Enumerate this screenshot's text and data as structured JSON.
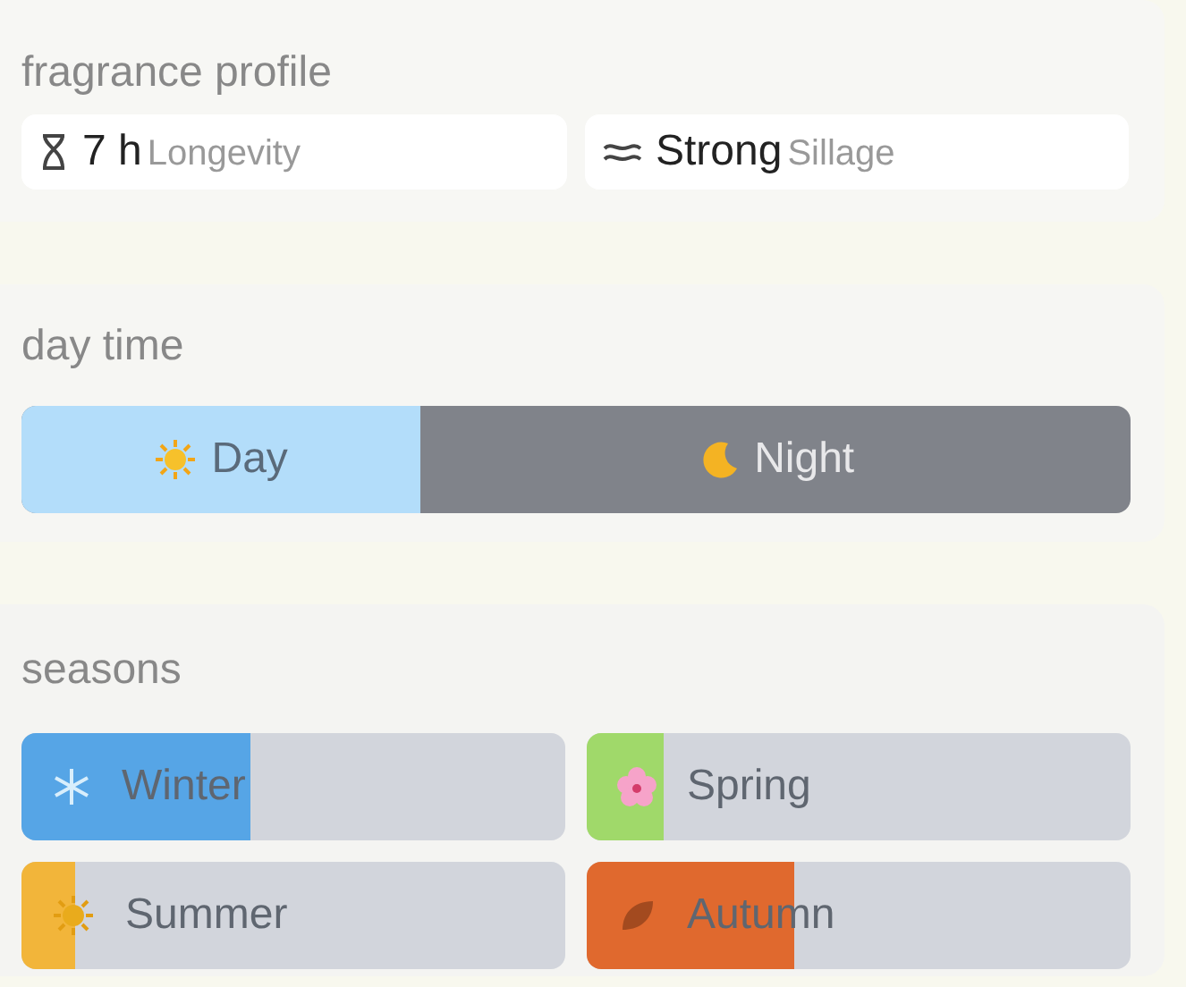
{
  "fragrance_profile": {
    "title": "fragrance profile",
    "stats": [
      {
        "kind": "longevity",
        "value": "7 h",
        "label": "Longevity"
      },
      {
        "kind": "sillage",
        "value": "Strong",
        "label": "Sillage"
      }
    ]
  },
  "day_time": {
    "title": "day time",
    "level": 0.36,
    "options": [
      {
        "kind": "day",
        "label": "Day"
      },
      {
        "kind": "night",
        "label": "Night"
      }
    ]
  },
  "seasons": {
    "title": "seasons",
    "items": [
      {
        "kind": "winter",
        "label": "Winter",
        "level": 0.42,
        "color": "#56a5e6"
      },
      {
        "kind": "spring",
        "label": "Spring",
        "level": 0.14,
        "color": "#a0d96a"
      },
      {
        "kind": "summer",
        "label": "Summer",
        "level": 0.1,
        "color": "#f2b53a"
      },
      {
        "kind": "autumn",
        "label": "Autumn",
        "level": 0.38,
        "color": "#e0692e"
      }
    ]
  }
}
